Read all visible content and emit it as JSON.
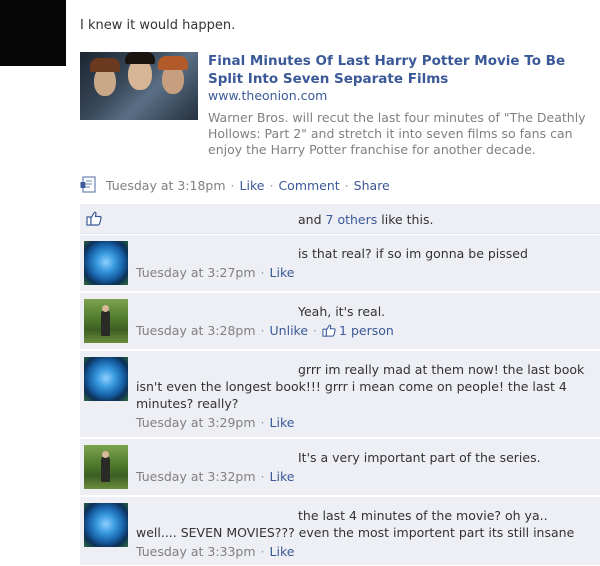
{
  "post": {
    "status_text": "I knew it would happen.",
    "share": {
      "title": "Final Minutes Of Last Harry Potter Movie To Be Split Into Seven Separate Films",
      "url": "www.theonion.com",
      "description": "Warner Bros. will recut the last four minutes of \"The Deathly Hollows: Part 2\" and stretch it into seven films so fans can enjoy the Harry Potter franchise for another decade."
    },
    "meta": {
      "time": "Tuesday at 3:18pm",
      "like_label": "Like",
      "comment_label": "Comment",
      "share_label": "Share"
    },
    "likes": {
      "prefix": "and",
      "others_link": "7 others",
      "suffix": "like this."
    }
  },
  "comments": [
    {
      "text": "is that real? if so im gonna be pissed",
      "time": "Tuesday at 3:27pm",
      "action": "Like",
      "avatar": "blue-rose"
    },
    {
      "text": "Yeah, it's real.",
      "time": "Tuesday at 3:28pm",
      "action": "Unlike",
      "likes": "1 person",
      "avatar": "forest-person"
    },
    {
      "text_first": "grrr im really mad at them now! the last book",
      "text_rest": "isn't even the longest book!!! grrr i mean come on people! the last 4 minutes? really?",
      "time": "Tuesday at 3:29pm",
      "action": "Like",
      "avatar": "blue-rose"
    },
    {
      "text": "It's a very important part of the series.",
      "time": "Tuesday at 3:32pm",
      "action": "Like",
      "avatar": "forest-person"
    },
    {
      "text_first": "the last 4 minutes of the movie? oh ya..",
      "text_rest": "well.... SEVEN MOVIES??? even the most importent part its still insane",
      "time": "Tuesday at 3:33pm",
      "action": "Like",
      "avatar": "blue-rose"
    }
  ],
  "colors": {
    "link": "#3b5998",
    "muted": "#808080",
    "comment_bg": "#edeff4"
  },
  "icons": [
    "note-icon",
    "thumbs-up-icon"
  ]
}
